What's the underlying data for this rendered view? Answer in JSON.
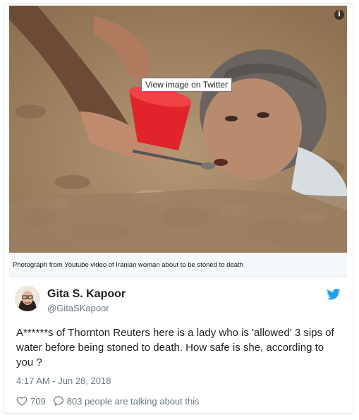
{
  "embed": {
    "info_icon_glyph": "i",
    "tooltip": "View image on Twitter",
    "caption": "Photograph from Youtube video of Iranian woman about to be stoned to death"
  },
  "tweet": {
    "display_name": "Gita S. Kapoor",
    "handle": "@GitaSKapoor",
    "text": "A******s of Thornton Reuters here is a lady who is 'allowed' 3 sips of water before being stoned to death. How safe is she, according to you ?",
    "timestamp": "4:17 AM - Jun 28, 2018",
    "likes": "709",
    "talking": "803 people are talking about this"
  },
  "colors": {
    "twitter_blue": "#1da1f2",
    "meta_gray": "#697882",
    "card_border": "#e1e8ed"
  },
  "icons": {
    "brand": "twitter-bird-icon",
    "like": "heart-icon",
    "reply": "speech-bubble-icon"
  }
}
